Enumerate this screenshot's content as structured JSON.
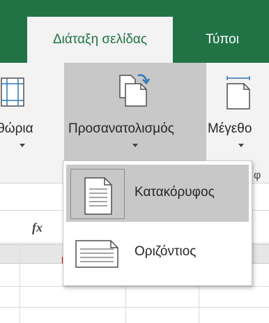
{
  "ribbon_tabs": {
    "active": "Διάταξη σελίδας",
    "next": "Τύποι"
  },
  "ribbon_buttons": {
    "margins_label": "ιθώρια",
    "orientation_label": "Προσανατολισμός",
    "size_label": "Μέγεθο"
  },
  "group_fragment": "φ",
  "formula_bar": {
    "fx_label": "fx"
  },
  "orientation_menu": {
    "items": [
      {
        "label": "Κατακόρυφος",
        "icon": "portrait-page-icon",
        "selected": true
      },
      {
        "label": "Οριζόντιος",
        "icon": "landscape-page-icon",
        "selected": false
      }
    ]
  },
  "colors": {
    "ribbon_green": "#217346",
    "ribbon_bg": "#f3f3f3",
    "hover_gray": "#c8c8c8"
  }
}
